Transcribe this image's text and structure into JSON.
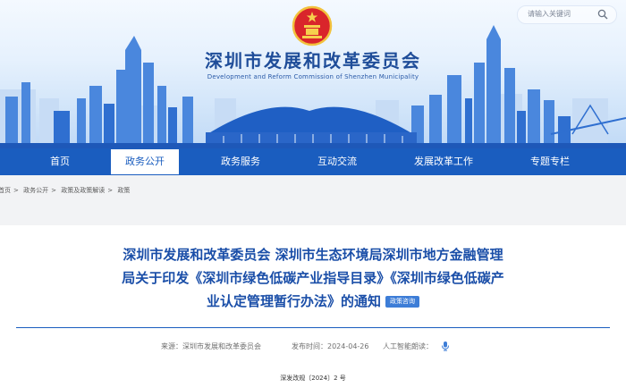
{
  "header": {
    "title": "深圳市发展和改革委员会",
    "subtitle": "Development and Reform Commission of Shenzhen Municipality",
    "search_placeholder": "请输入关键词"
  },
  "nav": {
    "items": [
      {
        "label": "首页"
      },
      {
        "label": "政务公开",
        "active": true
      },
      {
        "label": "政务服务"
      },
      {
        "label": "互动交流"
      },
      {
        "label": "发展改革工作"
      },
      {
        "label": "专题专栏"
      }
    ]
  },
  "breadcrumb": [
    "首页",
    "政务公开",
    "政策及政策解读",
    "政策"
  ],
  "breadcrumb_separator": ">",
  "article": {
    "title_line1": "深圳市发展和改革委员会 深圳市生态环境局深圳市地方金融管理",
    "title_line2": "局关于印发《深圳市绿色低碳产业指导目录》《深圳市绿色低碳产",
    "title_line3": "业认定管理暂行办法》的通知",
    "tag": "政策咨询",
    "source_label": "来源：深圳市发展和改革委员会",
    "date_label": "发布时间：2024-04-26",
    "ai_reading_label": "人工智能朗读：",
    "document_number": "深发改规〔2024〕2 号"
  },
  "colors": {
    "nav_bg": "#1a5dbf",
    "title_blue": "#1a4ea8",
    "tag_bg": "#3d7dd7"
  }
}
